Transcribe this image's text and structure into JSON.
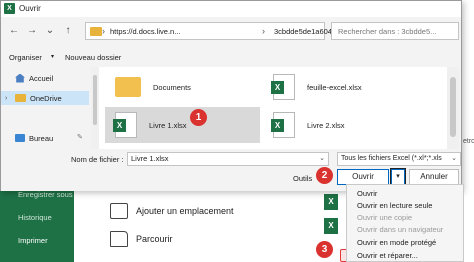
{
  "dialog": {
    "title": "Ouvrir",
    "address": {
      "path_start": "https://d.docs.live.n...",
      "path_end": "3cbdde5de1a604d7"
    },
    "search_placeholder": "Rechercher dans : 3cbdde5...",
    "toolbar": {
      "organize": "Organiser",
      "new_folder": "Nouveau dossier"
    },
    "nav": [
      {
        "label": "Accueil",
        "icon": "home-icon"
      },
      {
        "label": "OneDrive",
        "icon": "folder-icon"
      },
      {
        "label": "Bureau",
        "icon": "desktop-icon"
      }
    ],
    "files": [
      {
        "name": "Documents",
        "type": "folder"
      },
      {
        "name": "feuille-excel.xlsx",
        "type": "excel"
      },
      {
        "name": "Livre 1.xlsx",
        "type": "excel",
        "selected": true
      },
      {
        "name": "Livre 2.xlsx",
        "type": "excel"
      }
    ],
    "filename_label": "Nom de fichier :",
    "filename_value": "Livre 1.xlsx",
    "filetype_value": "Tous les fichiers Excel (*.xl*;*.xls",
    "tools_label": "Outils",
    "open_button": "Ouvrir",
    "cancel_button": "Annuler"
  },
  "open_menu": {
    "items": [
      {
        "label": "Ouvrir",
        "enabled": true
      },
      {
        "label": "Ouvrir en lecture seule",
        "enabled": true
      },
      {
        "label": "Ouvrir une copie",
        "enabled": false
      },
      {
        "label": "Ouvrir dans un navigateur",
        "enabled": false
      },
      {
        "label": "Ouvrir en mode protégé",
        "enabled": true
      },
      {
        "label": "Ouvrir et réparer...",
        "enabled": true,
        "highlighted": true
      }
    ]
  },
  "backstage": {
    "sidebar": [
      "Enregistrer sous",
      "Historique",
      "Imprimer"
    ],
    "places": [
      "Ajouter un emplacement",
      "Parcourir"
    ],
    "edge_text": "etro"
  },
  "badges": [
    "1",
    "2",
    "3"
  ],
  "colors": {
    "excel_green": "#1e7145",
    "selection_blue": "#cce4f7",
    "badge_red": "#d9322f",
    "accent_blue": "#0067c0"
  }
}
